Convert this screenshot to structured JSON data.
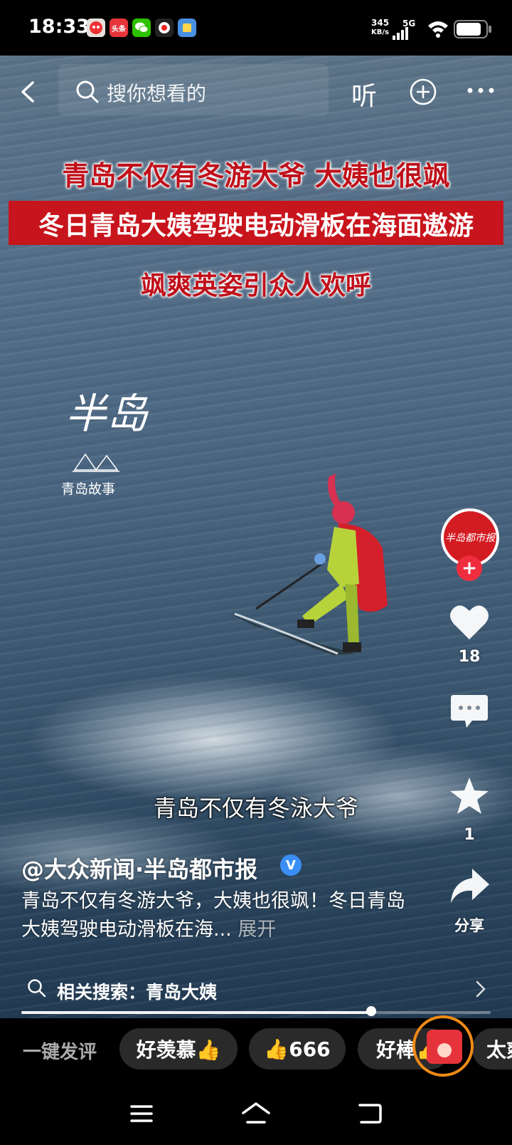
{
  "status_bar": {
    "time": "18:33",
    "net_speed_value": "345",
    "net_speed_unit": "KB/s",
    "network": "5G",
    "app_icons": [
      "toutiao-alt-icon",
      "toutiao-icon",
      "wechat-icon",
      "camera-app-icon",
      "blue-app-icon"
    ],
    "app_icon_text": [
      "",
      "头条",
      "",
      "",
      ""
    ]
  },
  "top_nav": {
    "search_placeholder": "搜你想看的",
    "listen_label": "听"
  },
  "video": {
    "caption_line1": "青岛不仅有冬游大爷 大姨也很飒",
    "caption_line2": "冬日青岛大姨驾驶电动滑板在海面遨游",
    "caption_line3": "飒爽英姿引众人欢呼",
    "watermark_main": "半岛",
    "watermark_sub": "青岛故事",
    "subtitle": "青岛不仅有冬泳大爷",
    "progress": 0.745
  },
  "right_rail": {
    "avatar_text": "半岛都市报",
    "likes": "18",
    "favorites": "1",
    "share_label": "分享"
  },
  "info": {
    "handle": "@大众新闻·半岛都市报",
    "verified_badge": "V",
    "description": "青岛不仅有冬游大爷，大姨也很飒！冬日青岛大姨驾驶电动滑板在海...",
    "expand_label": "展开"
  },
  "related_search": {
    "label": "相关搜索：青岛大姨"
  },
  "comment_bar": {
    "label": "一键发评",
    "chips": [
      "好羡慕👍",
      "👍666",
      "好棒👍",
      "太爽"
    ]
  },
  "colors": {
    "caption_red": "#c8141c",
    "follow_red": "#ef2d3f",
    "verified_blue": "#3a8ef6",
    "redpacket_ring": "#f08a16"
  }
}
